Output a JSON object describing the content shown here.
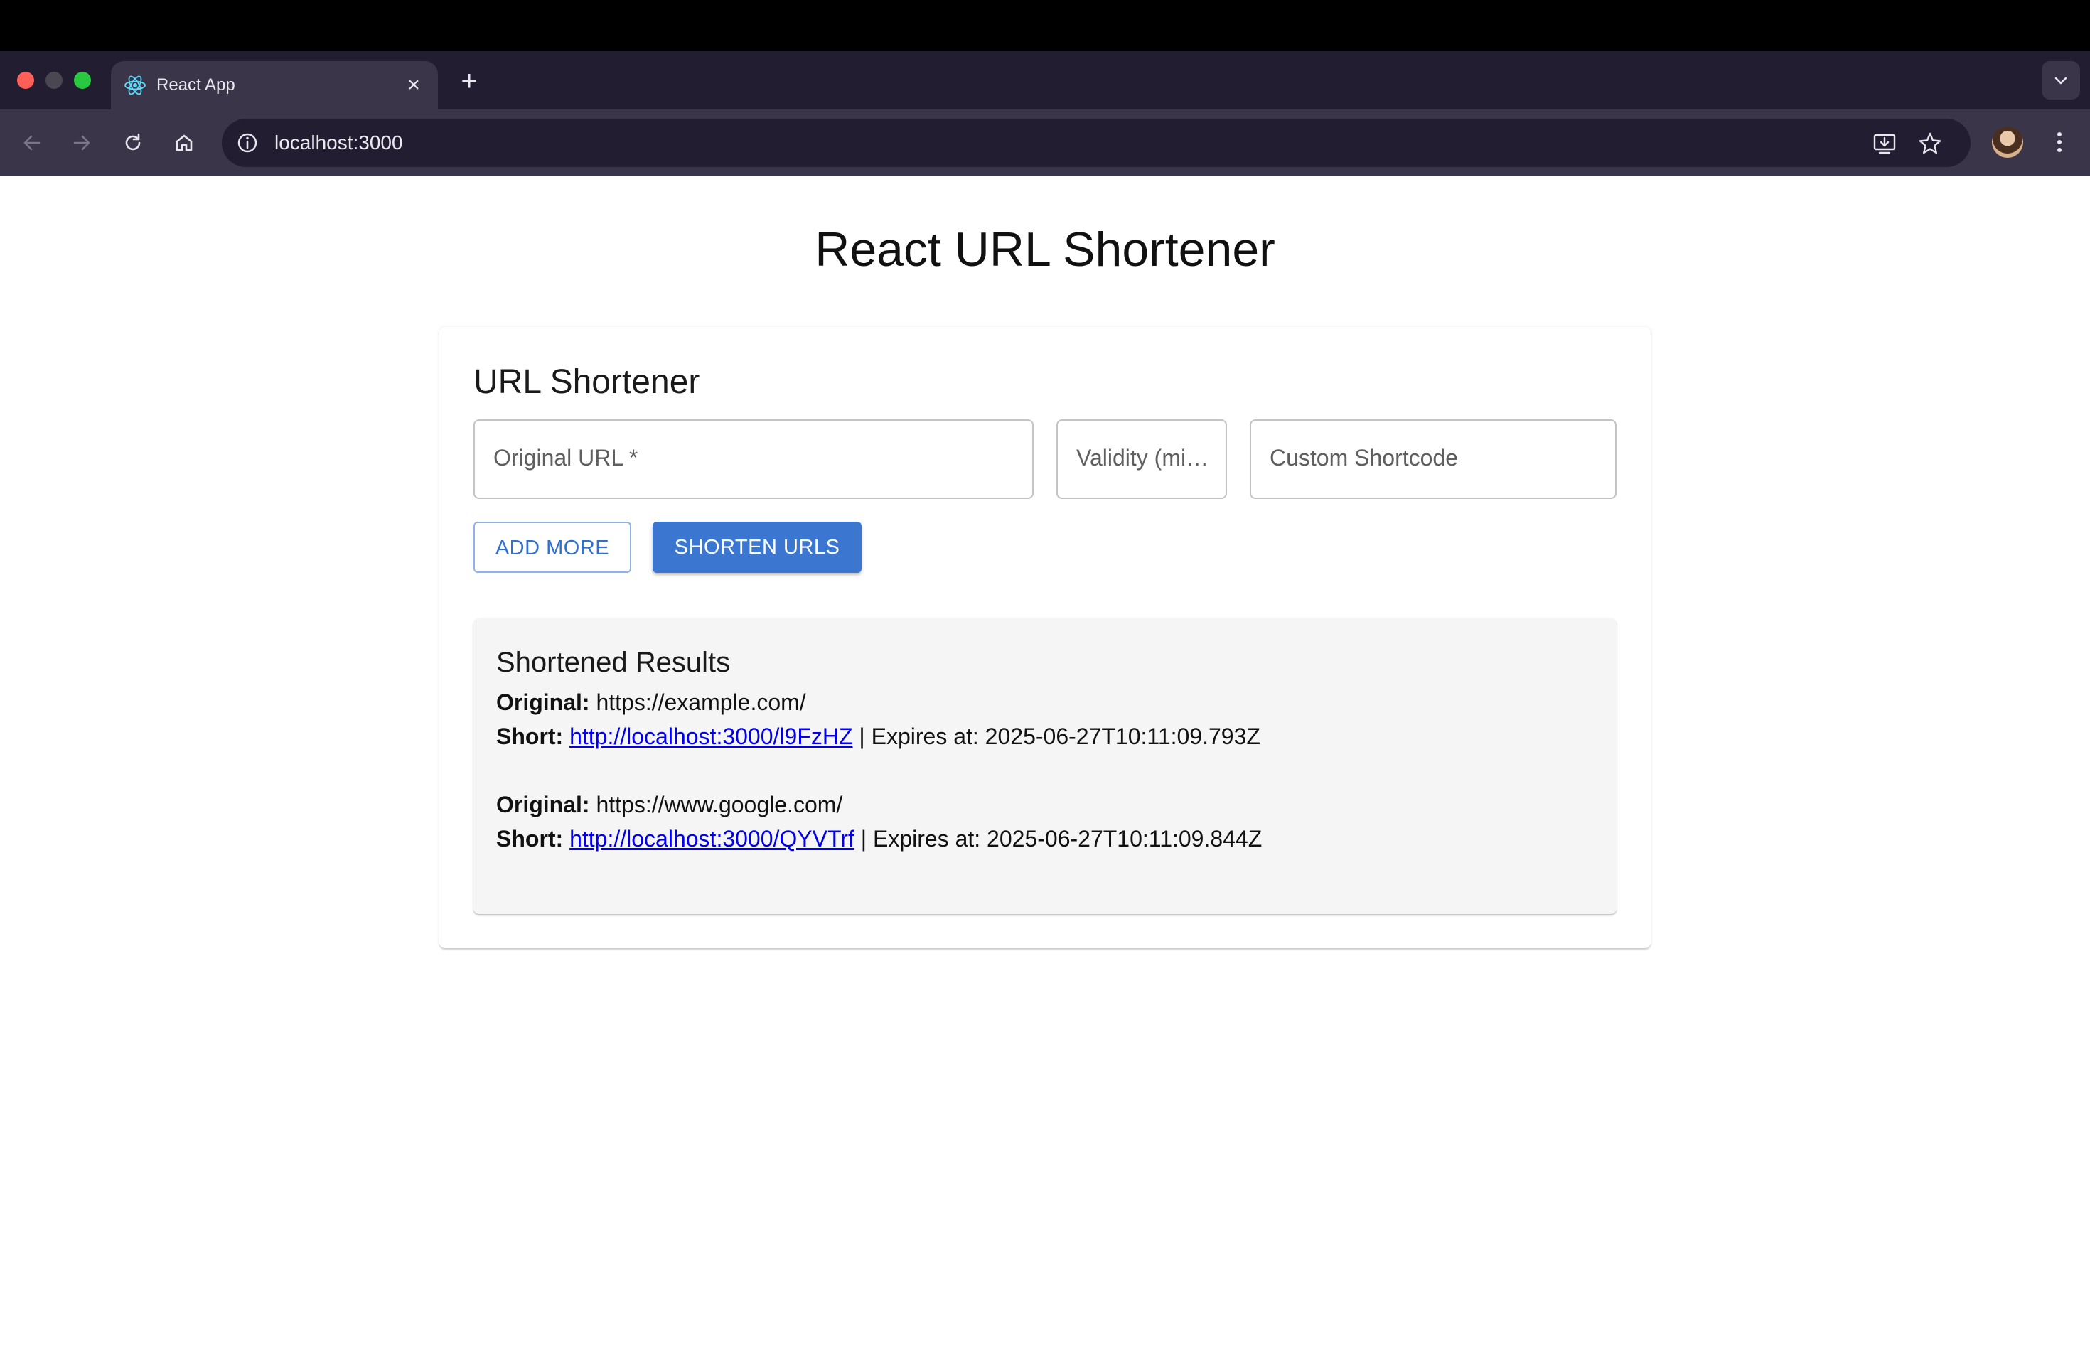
{
  "browser": {
    "tab_title": "React App",
    "tab_close": "×",
    "new_tab": "+",
    "address": "localhost:3000"
  },
  "page": {
    "title": "React URL Shortener"
  },
  "form": {
    "card_title": "URL Shortener",
    "original_url_placeholder": "Original URL *",
    "validity_placeholder": "Validity (mi…",
    "shortcode_placeholder": "Custom Shortcode",
    "add_more_label": "ADD MORE",
    "shorten_label": "SHORTEN URLS"
  },
  "results": {
    "title": "Shortened Results",
    "original_label": "Original:",
    "short_label": "Short:",
    "expires_label": "| Expires at:",
    "items": [
      {
        "original": "https://example.com/",
        "short": "http://localhost:3000/l9FzHZ",
        "expires": "2025-06-27T10:11:09.793Z"
      },
      {
        "original": "https://www.google.com/",
        "short": "http://localhost:3000/QYVTrf",
        "expires": "2025-06-27T10:11:09.844Z"
      }
    ]
  },
  "colors": {
    "chrome_dark": "#221d31",
    "chrome_toolbar": "#3b3549",
    "primary": "#3b77d1",
    "link": "#0000ee"
  }
}
